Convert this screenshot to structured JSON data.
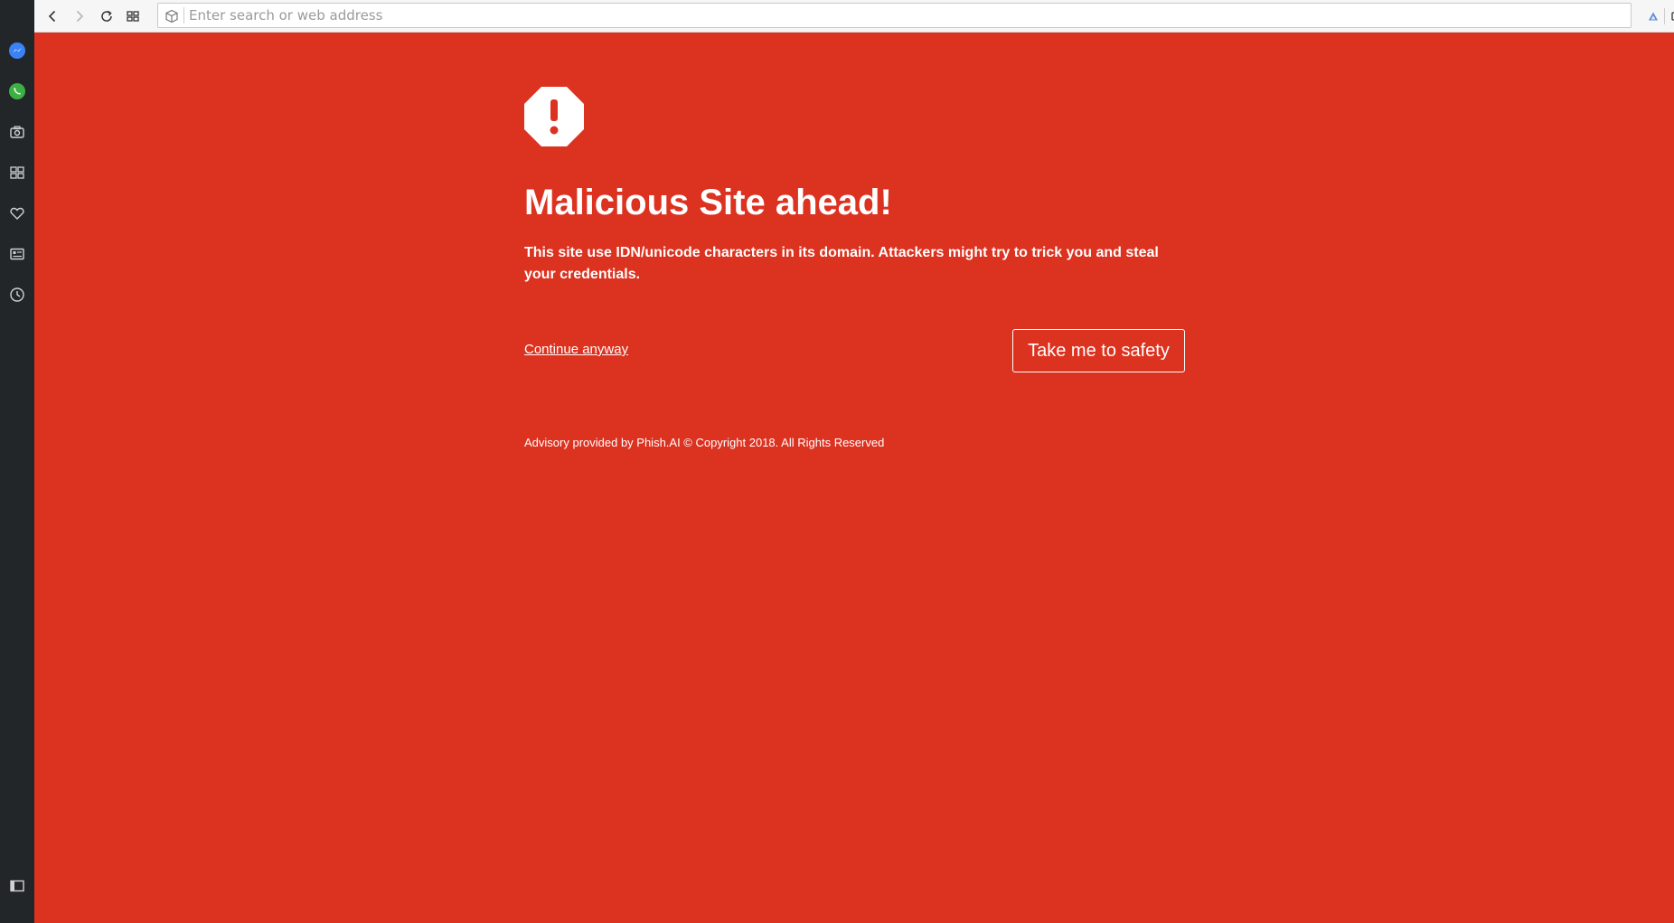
{
  "browser": {
    "address_placeholder": "Enter search or web address",
    "toolbar_icons": [
      "back-icon",
      "forward-icon",
      "reload-icon",
      "speed-dial-icon",
      "site-info-icon",
      "vpn-icon",
      "battery-saver-icon"
    ],
    "sidebar_icons": [
      "messenger-icon",
      "whatsapp-icon",
      "snapshot-icon",
      "speed-dial-icon",
      "bookmarks-icon",
      "news-icon",
      "history-icon",
      "sidebar-toggle-icon"
    ]
  },
  "warning": {
    "icon": "alert-octagon-icon",
    "title": "Malicious Site ahead!",
    "description": "This site use IDN/unicode characters in its domain. Attackers might try to trick you and steal your credentials.",
    "continue_label": "Continue anyway",
    "safety_label": "Take me to safety",
    "footer": "Advisory provided by Phish.AI © Copyright 2018. All Rights Reserved"
  },
  "colors": {
    "page_background": "#dc3220",
    "sidebar_background": "#232629",
    "text": "#ffffff"
  }
}
